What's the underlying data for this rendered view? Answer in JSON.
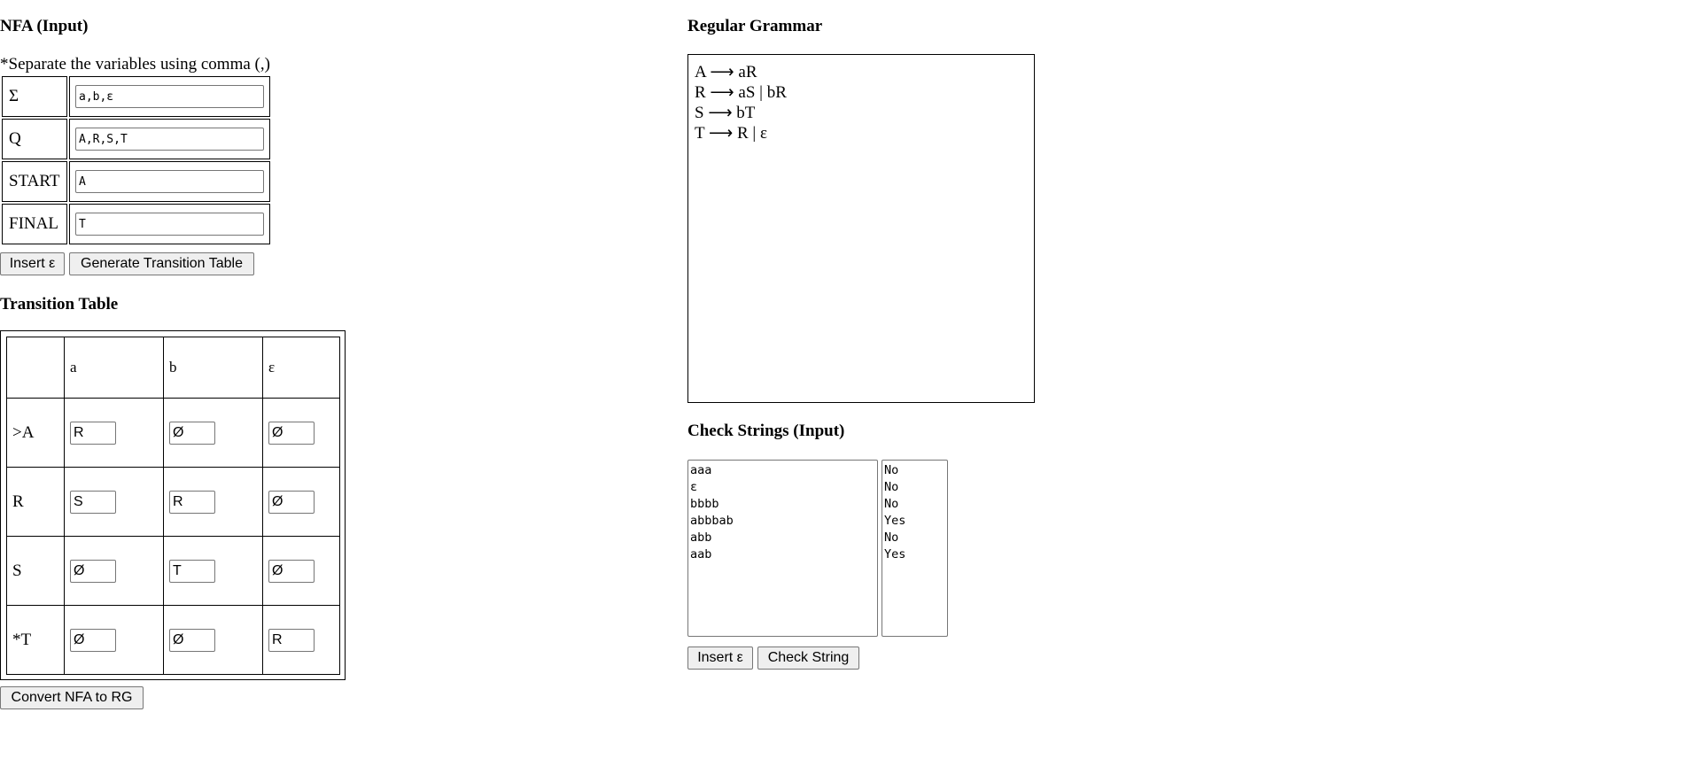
{
  "nfa": {
    "title": "NFA (Input)",
    "note": "*Separate the variables using comma (,)",
    "fields": [
      {
        "label": "Σ",
        "value": "a,b,ε"
      },
      {
        "label": "Q",
        "value": "A,R,S,T"
      },
      {
        "label": "START",
        "value": "A"
      },
      {
        "label": "FINAL",
        "value": "T"
      }
    ],
    "insert_epsilon_label": "Insert ε",
    "generate_label": "Generate Transition Table"
  },
  "transition": {
    "title": "Transition Table",
    "headers": [
      "",
      "a",
      "b",
      "ε"
    ],
    "rows": [
      {
        "state": ">A",
        "cells": [
          "R",
          "Ø",
          "Ø"
        ]
      },
      {
        "state": "R",
        "cells": [
          "S",
          "R",
          "Ø"
        ]
      },
      {
        "state": "S",
        "cells": [
          "Ø",
          "T",
          "Ø"
        ]
      },
      {
        "state": "*T",
        "cells": [
          "Ø",
          "Ø",
          "R"
        ]
      }
    ],
    "convert_label": "Convert NFA to RG"
  },
  "grammar": {
    "title": "Regular Grammar",
    "lines": [
      "A ⟶ aR",
      "R ⟶ aS | bR",
      "S ⟶ bT",
      "T ⟶ R | ε"
    ]
  },
  "check": {
    "title": "Check Strings (Input)",
    "strings": "aaa\nε\nbbbb\nabbbab\nabb\naab",
    "results": "No\nNo\nNo\nYes\nNo\nYes",
    "insert_epsilon_label": "Insert ε",
    "check_label": "Check String"
  }
}
